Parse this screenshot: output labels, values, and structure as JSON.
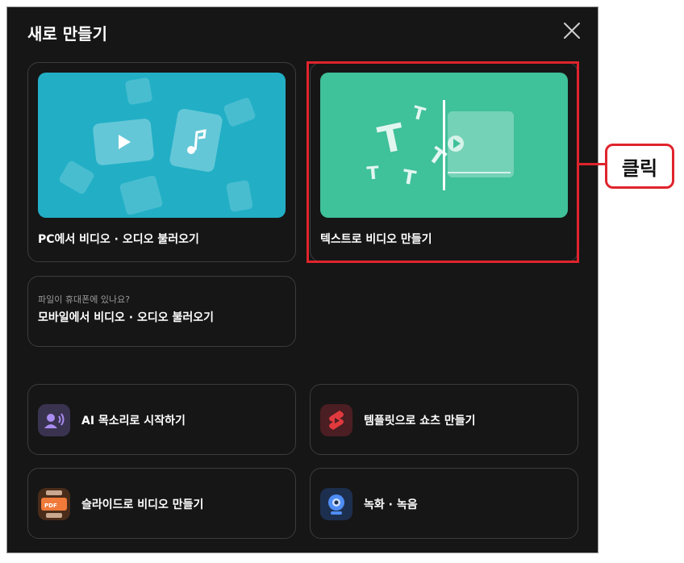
{
  "dialog": {
    "title": "새로 만들기"
  },
  "cards": {
    "pc_import": {
      "label": "PC에서 비디오 · 오디오 불러오기"
    },
    "text_to_video": {
      "label": "텍스트로 비디오 만들기"
    },
    "mobile_import": {
      "hint": "파일이 휴대폰에 있나요?",
      "label": "모바일에서 비디오 · 오디오 불러오기"
    }
  },
  "options": {
    "ai_voice": "AI 목소리로 시작하기",
    "template_shorts": "템플릿으로 쇼츠 만들기",
    "slides_video": "슬라이드로 비디오 만들기",
    "record": "녹화 · 녹음"
  },
  "annotation": {
    "callout_text": "클릭"
  },
  "colors": {
    "highlight": "#e0242c",
    "pc_thumb": "#22afc6",
    "text_thumb": "#3fc19a"
  }
}
